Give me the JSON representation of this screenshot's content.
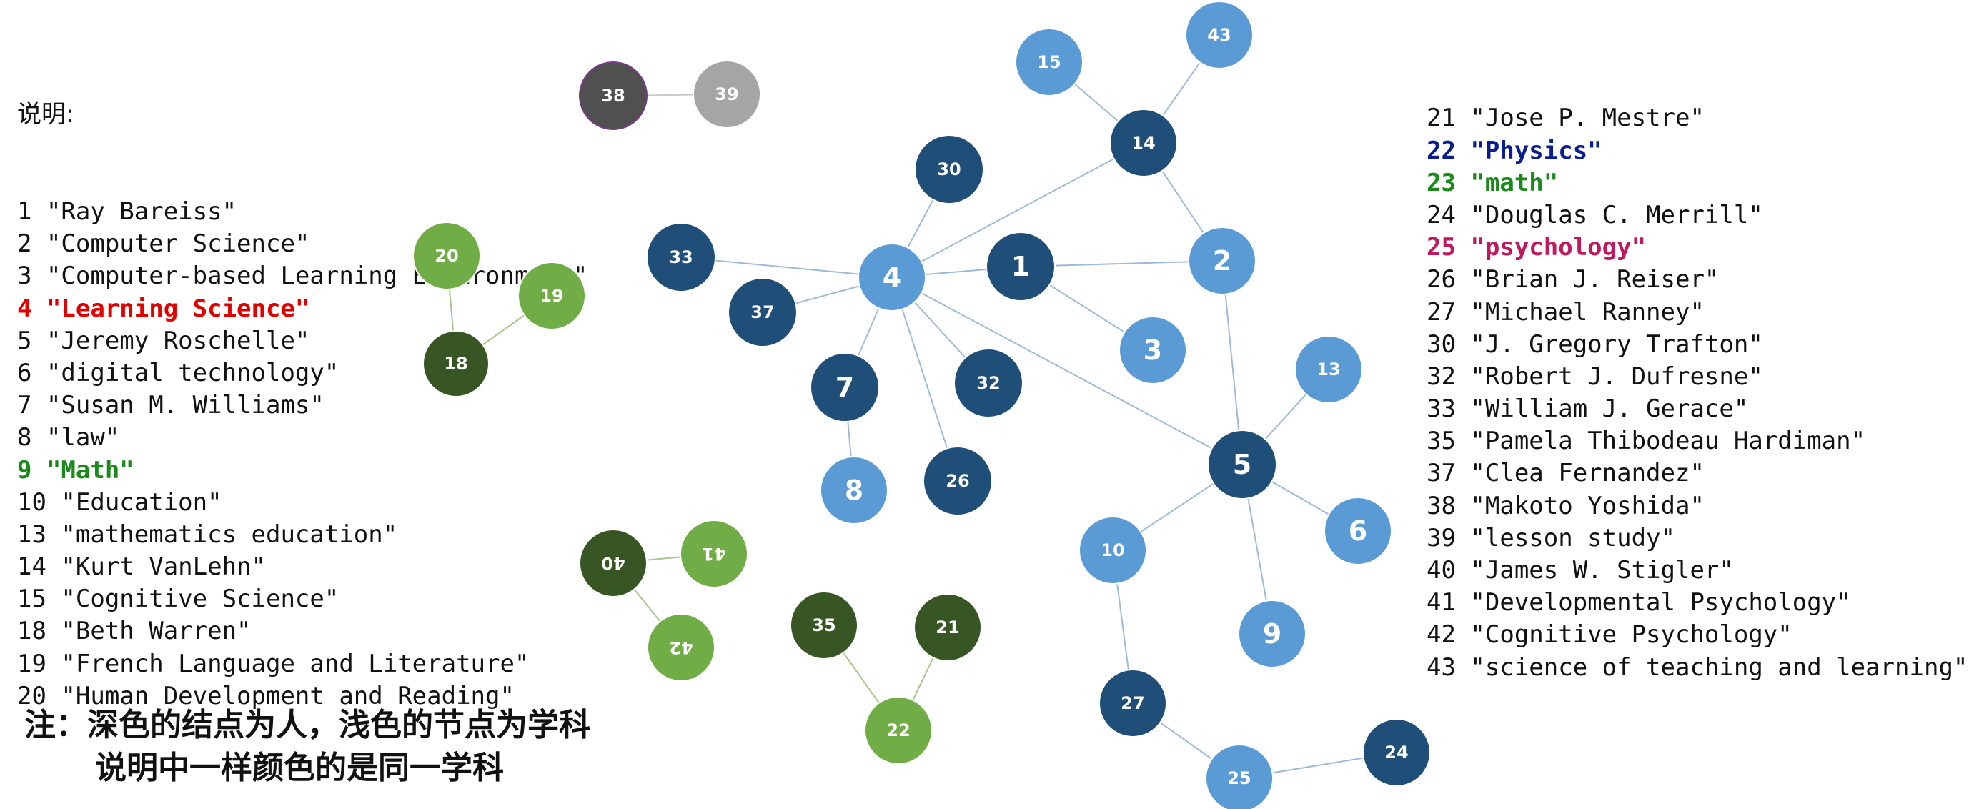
{
  "legend_left": {
    "heading": "说明:",
    "entries": [
      {
        "text": "1 \"Ray Bareiss\""
      },
      {
        "text": "2 \"Computer Science\""
      },
      {
        "text": "3 \"Computer-based Learning Environment\""
      },
      {
        "text": "4 \"Learning Science\"",
        "color": "#e00000",
        "bold": true
      },
      {
        "text": "5 \"Jeremy Roschelle\""
      },
      {
        "text": "6 \"digital technology\""
      },
      {
        "text": "7 \"Susan M. Williams\""
      },
      {
        "text": "8 \"law\""
      },
      {
        "text": "9 \"Math\"",
        "color": "#1a8a1a",
        "bold": true
      },
      {
        "text": "10 \"Education\""
      },
      {
        "text": "13 \"mathematics education\""
      },
      {
        "text": "14 \"Kurt VanLehn\""
      },
      {
        "text": "15 \"Cognitive Science\""
      },
      {
        "text": "18 \"Beth Warren\""
      },
      {
        "text": "19 \"French Language and Literature\""
      },
      {
        "text": "20 \"Human Development and Reading\""
      }
    ]
  },
  "legend_right": {
    "entries": [
      {
        "text": "21 \"Jose P. Mestre\""
      },
      {
        "text": "22 \"Physics\"",
        "color": "#0a1f8f",
        "bold": true
      },
      {
        "text": "23 \"math\"",
        "color": "#1a8a1a",
        "bold": true
      },
      {
        "text": "24 \"Douglas C. Merrill\""
      },
      {
        "text": "25 \"psychology\"",
        "color": "#c0185f",
        "bold": true
      },
      {
        "text": "26 \"Brian J. Reiser\""
      },
      {
        "text": "27 \"Michael Ranney\""
      },
      {
        "text": "30 \"J. Gregory Trafton\""
      },
      {
        "text": "32 \"Robert J. Dufresne\""
      },
      {
        "text": "33 \"William J. Gerace\""
      },
      {
        "text": "35 \"Pamela Thibodeau Hardiman\""
      },
      {
        "text": "37 \"Clea Fernandez\""
      },
      {
        "text": "38 \"Makoto Yoshida\""
      },
      {
        "text": "39 \"lesson study\""
      },
      {
        "text": "40 \"James W. Stigler\""
      },
      {
        "text": "41 \"Developmental Psychology\""
      },
      {
        "text": "42 \"Cognitive Psychology\""
      },
      {
        "text": "43 \"science of teaching and learning\""
      }
    ]
  },
  "note": {
    "line1": "注：深色的结点为人，浅色的节点为学科",
    "line2": "说明中一样颜色的是同一学科"
  },
  "palette": {
    "blue_dark": "#1f4e79",
    "blue_light": "#5b9bd5",
    "green_dark": "#375623",
    "green_light": "#70ad47",
    "gray_dark": "#505050",
    "gray_light": "#a5a5a5",
    "node_border": "#ffffff",
    "edge_blue": "#9dbbd9",
    "edge_green": "#a9c58a",
    "edge_gray": "#c8c8c8"
  },
  "graph": {
    "nodes": [
      {
        "id": "1",
        "label": "1",
        "kind": "person",
        "group": "blue"
      },
      {
        "id": "2",
        "label": "2",
        "kind": "subject",
        "group": "blue"
      },
      {
        "id": "3",
        "label": "3",
        "kind": "subject",
        "group": "blue"
      },
      {
        "id": "4",
        "label": "4",
        "kind": "subject",
        "group": "blue"
      },
      {
        "id": "5",
        "label": "5",
        "kind": "person",
        "group": "blue"
      },
      {
        "id": "6",
        "label": "6",
        "kind": "subject",
        "group": "blue"
      },
      {
        "id": "7",
        "label": "7",
        "kind": "person",
        "group": "blue"
      },
      {
        "id": "8",
        "label": "8",
        "kind": "subject",
        "group": "blue"
      },
      {
        "id": "9",
        "label": "9",
        "kind": "subject",
        "group": "blue"
      },
      {
        "id": "10",
        "label": "10",
        "kind": "subject",
        "group": "blue"
      },
      {
        "id": "13",
        "label": "13",
        "kind": "subject",
        "group": "blue"
      },
      {
        "id": "14",
        "label": "14",
        "kind": "person",
        "group": "blue"
      },
      {
        "id": "15",
        "label": "15",
        "kind": "subject",
        "group": "blue"
      },
      {
        "id": "24",
        "label": "24",
        "kind": "person",
        "group": "blue"
      },
      {
        "id": "25",
        "label": "25",
        "kind": "subject",
        "group": "blue"
      },
      {
        "id": "26",
        "label": "26",
        "kind": "person",
        "group": "blue"
      },
      {
        "id": "27",
        "label": "27",
        "kind": "person",
        "group": "blue"
      },
      {
        "id": "30",
        "label": "30",
        "kind": "person",
        "group": "blue"
      },
      {
        "id": "32",
        "label": "32",
        "kind": "person",
        "group": "blue"
      },
      {
        "id": "33",
        "label": "33",
        "kind": "person",
        "group": "blue"
      },
      {
        "id": "37",
        "label": "37",
        "kind": "person",
        "group": "blue"
      },
      {
        "id": "43",
        "label": "43",
        "kind": "subject",
        "group": "blue"
      },
      {
        "id": "18",
        "label": "18",
        "kind": "person",
        "group": "green"
      },
      {
        "id": "19",
        "label": "19",
        "kind": "subject",
        "group": "green"
      },
      {
        "id": "20",
        "label": "20",
        "kind": "subject",
        "group": "green"
      },
      {
        "id": "21",
        "label": "21",
        "kind": "person",
        "group": "green"
      },
      {
        "id": "22",
        "label": "22",
        "kind": "subject",
        "group": "green"
      },
      {
        "id": "35",
        "label": "35",
        "kind": "person",
        "group": "green"
      },
      {
        "id": "40",
        "label": "40",
        "kind": "person",
        "group": "green",
        "flipped": true
      },
      {
        "id": "41",
        "label": "41",
        "kind": "subject",
        "group": "green",
        "flipped": true
      },
      {
        "id": "42",
        "label": "42",
        "kind": "subject",
        "group": "green",
        "flipped": true
      },
      {
        "id": "38",
        "label": "38",
        "kind": "person",
        "group": "gray"
      },
      {
        "id": "39",
        "label": "39",
        "kind": "subject",
        "group": "gray"
      }
    ],
    "edges": [
      {
        "from": "4",
        "to": "1"
      },
      {
        "from": "4",
        "to": "30"
      },
      {
        "from": "4",
        "to": "33"
      },
      {
        "from": "4",
        "to": "37"
      },
      {
        "from": "4",
        "to": "7"
      },
      {
        "from": "4",
        "to": "26"
      },
      {
        "from": "4",
        "to": "32"
      },
      {
        "from": "4",
        "to": "5"
      },
      {
        "from": "4",
        "to": "14"
      },
      {
        "from": "1",
        "to": "2"
      },
      {
        "from": "1",
        "to": "3"
      },
      {
        "from": "7",
        "to": "8"
      },
      {
        "from": "14",
        "to": "15"
      },
      {
        "from": "14",
        "to": "43"
      },
      {
        "from": "14",
        "to": "2"
      },
      {
        "from": "2",
        "to": "5"
      },
      {
        "from": "5",
        "to": "13"
      },
      {
        "from": "5",
        "to": "6"
      },
      {
        "from": "5",
        "to": "9"
      },
      {
        "from": "5",
        "to": "10"
      },
      {
        "from": "10",
        "to": "27"
      },
      {
        "from": "27",
        "to": "25"
      },
      {
        "from": "25",
        "to": "24"
      },
      {
        "from": "18",
        "to": "20"
      },
      {
        "from": "18",
        "to": "19"
      },
      {
        "from": "40",
        "to": "41"
      },
      {
        "from": "40",
        "to": "42"
      },
      {
        "from": "22",
        "to": "35"
      },
      {
        "from": "22",
        "to": "21"
      },
      {
        "from": "38",
        "to": "39"
      }
    ]
  }
}
